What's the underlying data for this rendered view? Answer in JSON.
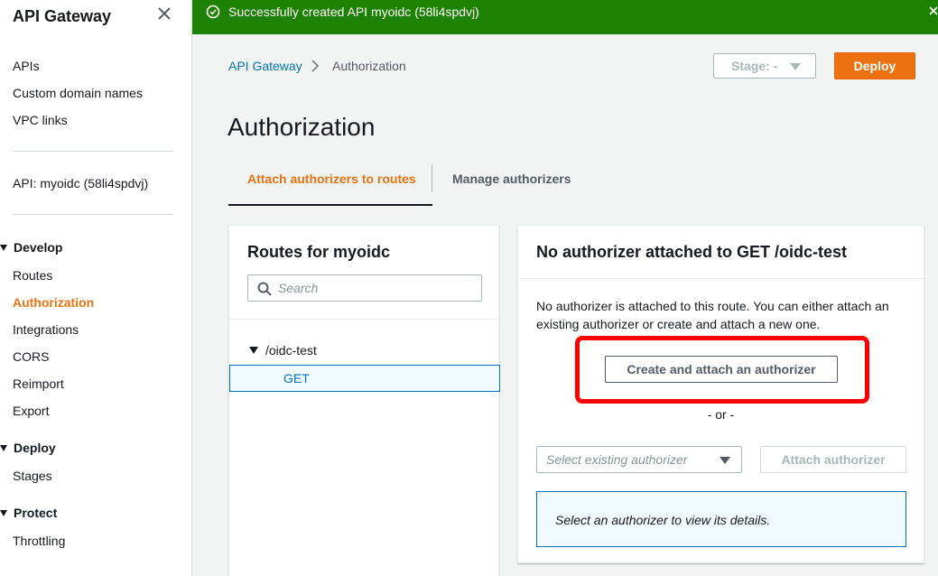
{
  "sidebar": {
    "title": "API Gateway",
    "top_links": [
      "APIs",
      "Custom domain names",
      "VPC links"
    ],
    "api_label": "API: myoidc (58li4spdvj)",
    "sections": [
      {
        "label": "Develop",
        "items": [
          "Routes",
          "Authorization",
          "Integrations",
          "CORS",
          "Reimport",
          "Export"
        ]
      },
      {
        "label": "Deploy",
        "items": [
          "Stages"
        ]
      },
      {
        "label": "Protect",
        "items": [
          "Throttling"
        ]
      }
    ],
    "active_item": "Authorization"
  },
  "flash": {
    "message": "Successfully created API myoidc (58li4spdvj)",
    "color": "#1d8102"
  },
  "breadcrumb": {
    "root": "API Gateway",
    "current": "Authorization"
  },
  "header": {
    "stage_label": "Stage: -",
    "deploy_label": "Deploy",
    "accent_color": "#ec7211"
  },
  "page": {
    "title": "Authorization",
    "tabs": [
      {
        "label": "Attach authorizers to routes",
        "active": true
      },
      {
        "label": "Manage authorizers",
        "active": false
      }
    ]
  },
  "routes": {
    "title": "Routes for myoidc",
    "search_placeholder": "Search",
    "tree": [
      {
        "path": "/oidc-test",
        "methods": [
          "GET"
        ]
      }
    ]
  },
  "authorizer": {
    "title": "No authorizer attached to GET /oidc-test",
    "description": "No authorizer is attached to this route. You can either attach an existing authorizer or create and attach a new one.",
    "create_label": "Create and attach an authorizer",
    "or_label": "- or -",
    "select_placeholder": "Select existing authorizer",
    "attach_label": "Attach authorizer",
    "details_hint": "Select an authorizer to view its details.",
    "highlight_color": "#ff0000"
  }
}
